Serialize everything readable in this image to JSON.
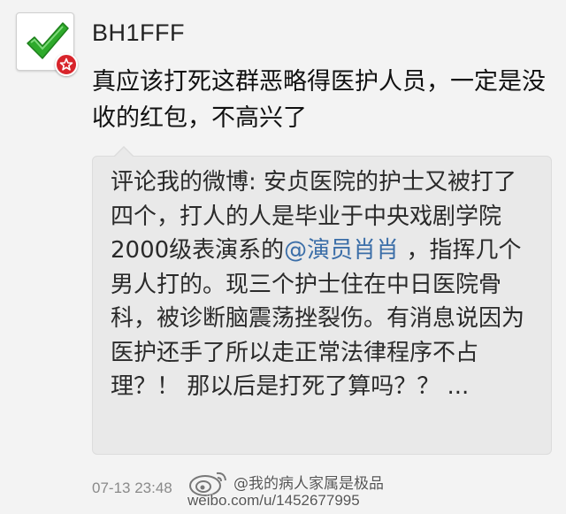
{
  "post": {
    "username": "BH1FFF",
    "text": "真应该打死这群恶略得医护人员，一定是没收的红包，不高兴了",
    "timestamp": "07-13 23:48"
  },
  "repost": {
    "text_before": "评论我的微博: 安贞医院的护士又被打了四个，打人的人是毕业于中央戏剧学院2000级表演系的",
    "mention": "@演员肖肖",
    "text_after": " ，指挥几个男人打的。现三个护士住在中日医院骨科，被诊断脑震荡挫裂伤。有消息说因为医护还手了所以走正常法律程序不占理？！ 那以后是打死了算吗？？ ..."
  },
  "watermark": {
    "name": "@我的病人家属是极品",
    "url": "weibo.com/u/1452677995"
  },
  "icons": {
    "avatar": "green-checkmark-icon",
    "badge": "verified-star-badge-icon",
    "watermark_logo": "weibo-eye-logo"
  },
  "colors": {
    "background": "#f3f3f3",
    "repost_background": "#e9e9e9",
    "mention": "#3b6ea8",
    "badge": "#d8242b",
    "check": "#2eaa2b"
  }
}
